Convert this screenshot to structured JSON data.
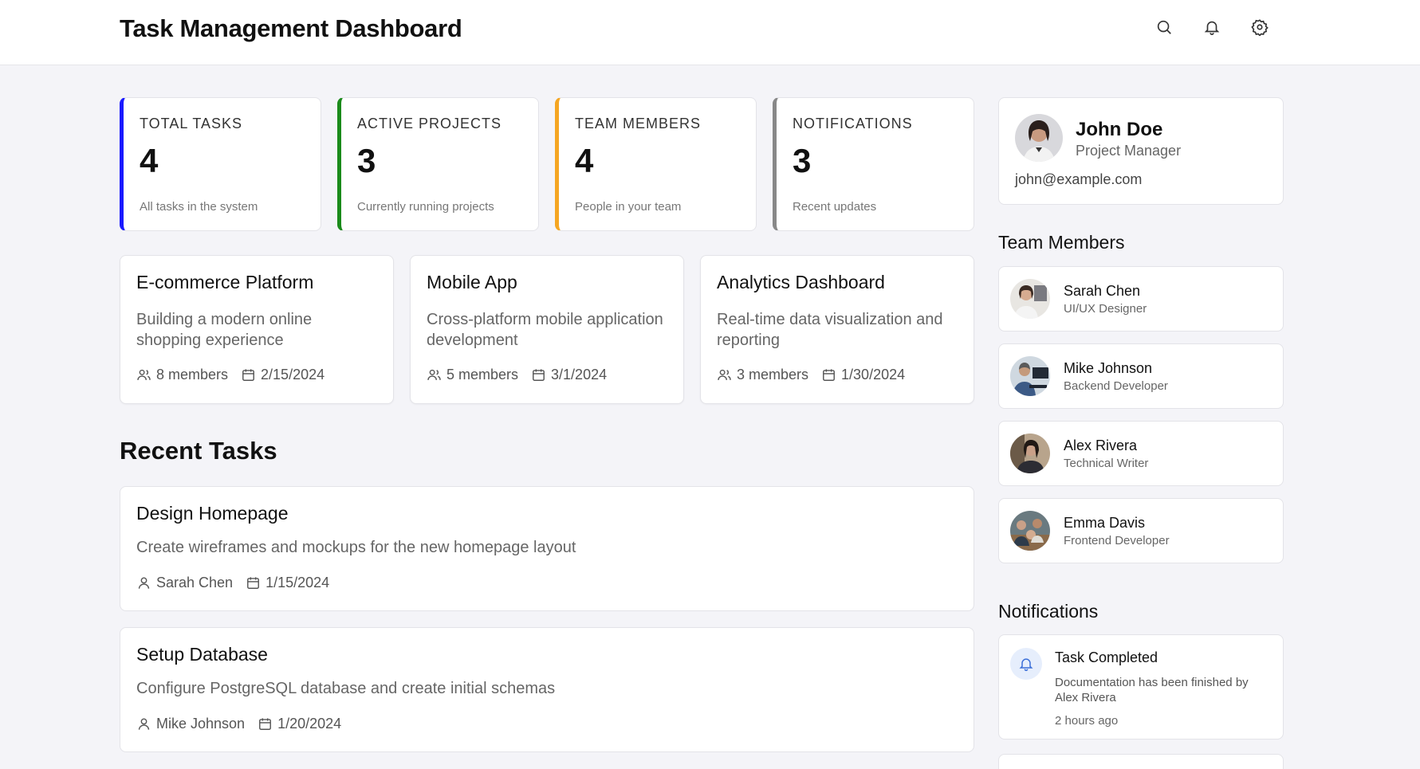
{
  "header": {
    "title": "Task Management Dashboard"
  },
  "stats": [
    {
      "label": "TOTAL TASKS",
      "value": "4",
      "desc": "All tasks in the system",
      "color": "#1a1aff"
    },
    {
      "label": "ACTIVE PROJECTS",
      "value": "3",
      "desc": "Currently running projects",
      "color": "#1a8a1a"
    },
    {
      "label": "TEAM MEMBERS",
      "value": "4",
      "desc": "People in your team",
      "color": "#f5a623"
    },
    {
      "label": "NOTIFICATIONS",
      "value": "3",
      "desc": "Recent updates",
      "color": "#888888"
    }
  ],
  "projects": [
    {
      "title": "E-commerce Platform",
      "desc": "Building a modern online shopping experience",
      "members": "8 members",
      "date": "2/15/2024"
    },
    {
      "title": "Mobile App",
      "desc": "Cross-platform mobile application development",
      "members": "5 members",
      "date": "3/1/2024"
    },
    {
      "title": "Analytics Dashboard",
      "desc": "Real-time data visualization and reporting",
      "members": "3 members",
      "date": "1/30/2024"
    }
  ],
  "recent_tasks": {
    "heading": "Recent Tasks",
    "items": [
      {
        "title": "Design Homepage",
        "desc": "Create wireframes and mockups for the new homepage layout",
        "assignee": "Sarah Chen",
        "date": "1/15/2024"
      },
      {
        "title": "Setup Database",
        "desc": "Configure PostgreSQL database and create initial schemas",
        "assignee": "Mike Johnson",
        "date": "1/20/2024"
      }
    ]
  },
  "profile": {
    "name": "John Doe",
    "role": "Project Manager",
    "email": "john@example.com"
  },
  "team": {
    "heading": "Team Members",
    "members": [
      {
        "name": "Sarah Chen",
        "role": "UI/UX Designer"
      },
      {
        "name": "Mike Johnson",
        "role": "Backend Developer"
      },
      {
        "name": "Alex Rivera",
        "role": "Technical Writer"
      },
      {
        "name": "Emma Davis",
        "role": "Frontend Developer"
      }
    ]
  },
  "notifications": {
    "heading": "Notifications",
    "items": [
      {
        "title": "Task Completed",
        "text": "Documentation has been finished by Alex Rivera",
        "time": "2 hours ago"
      }
    ]
  }
}
